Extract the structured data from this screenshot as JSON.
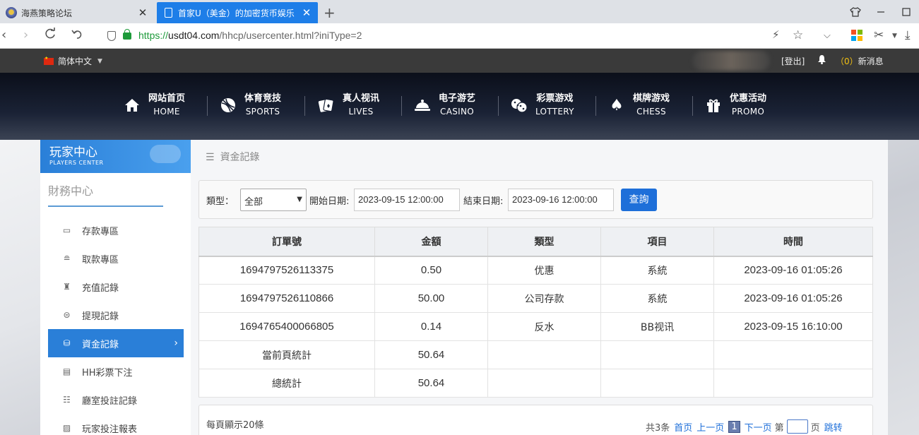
{
  "browser": {
    "tabs": [
      {
        "title": "海燕策略论坛",
        "close": "✕"
      },
      {
        "title": "首家U（美金）的加密货币娱乐",
        "close": "✕"
      }
    ],
    "new_tab": "+",
    "url_proto": "https://",
    "url_host": "usdt04.com",
    "url_path": "/hhcp/usercenter.html?iniType=2"
  },
  "topbar": {
    "language": "简体中文",
    "logout": "[登出]",
    "msg_count": "（0）",
    "msg_label": "新消息"
  },
  "nav": [
    {
      "cn": "网站首页",
      "en": "HOME",
      "icon": "home-icon"
    },
    {
      "cn": "体育竞技",
      "en": "SPORTS",
      "icon": "ball-icon"
    },
    {
      "cn": "真人视讯",
      "en": "LIVES",
      "icon": "cards-icon"
    },
    {
      "cn": "电子游艺",
      "en": "CASINO",
      "icon": "dish-icon"
    },
    {
      "cn": "彩票游戏",
      "en": "LOTTERY",
      "icon": "dice-icon"
    },
    {
      "cn": "棋牌游戏",
      "en": "CHESS",
      "icon": "spade-icon"
    },
    {
      "cn": "优惠活动",
      "en": "PROMO",
      "icon": "gift-icon"
    }
  ],
  "sidebar": {
    "header_cn": "玩家中心",
    "header_en": "PLAYERS CENTER",
    "section": "財務中心",
    "items": [
      {
        "label": "存款專區",
        "icon": "card-icon"
      },
      {
        "label": "取款專區",
        "icon": "cash-icon"
      },
      {
        "label": "充值記錄",
        "icon": "bag-icon"
      },
      {
        "label": "提現記錄",
        "icon": "withdraw-icon"
      },
      {
        "label": "資金記錄",
        "icon": "fund-icon",
        "active": true
      },
      {
        "label": "HH彩票下注",
        "icon": "ticket-icon"
      },
      {
        "label": "廳室投註記錄",
        "icon": "list-icon"
      },
      {
        "label": "玩家投注報表",
        "icon": "report-icon"
      }
    ]
  },
  "main": {
    "breadcrumb": "資金記錄",
    "filter": {
      "type_label": "類型：",
      "type_value": "全部",
      "start_label": "開始日期:",
      "start_value": "2023-09-15 12:00:00",
      "end_label": "結束日期:",
      "end_value": "2023-09-16 12:00:00",
      "query": "查詢"
    },
    "table": {
      "headers": [
        "訂單號",
        "金額",
        "類型",
        "項目",
        "時間"
      ],
      "rows": [
        [
          "1694797526113375",
          "0.50",
          "优惠",
          "系統",
          "2023-09-16 01:05:26"
        ],
        [
          "1694797526110866",
          "50.00",
          "公司存款",
          "系統",
          "2023-09-16 01:05:26"
        ],
        [
          "1694765400066805",
          "0.14",
          "反水",
          "BB视讯",
          "2023-09-15 16:10:00"
        ],
        [
          "當前頁統計",
          "50.64",
          "",
          "",
          ""
        ],
        [
          "總統計",
          "50.64",
          "",
          "",
          ""
        ]
      ]
    },
    "footer": {
      "per_page": "每頁顯示20條",
      "total": "共3条",
      "first": "首页",
      "prev": "上一页",
      "current": "1",
      "next": "下一页",
      "page_pre": "第",
      "page_post": "页",
      "jump": "跳转"
    }
  }
}
